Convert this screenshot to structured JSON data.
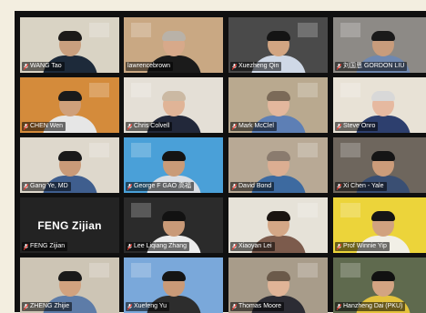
{
  "meeting": {
    "participants": [
      {
        "name": "WANG Tao",
        "muted": true,
        "bg": "#d9d3c4",
        "skin": "#c99f7e",
        "hair": "#1c1a18",
        "shirt": "#1d2a3a"
      },
      {
        "name": "lawrencebrown",
        "muted": false,
        "bg": "#c9a883",
        "skin": "#d7a98a",
        "hair": "#b9b2a8",
        "shirt": "#1b1b1b"
      },
      {
        "name": "Xuezheng Qin",
        "muted": true,
        "bg": "#4a4a4a",
        "skin": "#d2a582",
        "hair": "#141414",
        "shirt": "#cfd8e6"
      },
      {
        "name": "刘国恩 GORDON LIU",
        "muted": true,
        "bg": "#8d8a86",
        "skin": "#c89c7c",
        "hair": "#1a1a1a",
        "shirt": "#6f88b0"
      },
      {
        "name": "CHEN Wen",
        "muted": true,
        "bg": "#d48b3b",
        "skin": "#cfa07b",
        "hair": "#1a1a1a",
        "shirt": "#e6e6e6"
      },
      {
        "name": "Chris Colvell",
        "muted": true,
        "bg": "#e4dfd6",
        "skin": "#e0b497",
        "hair": "#cbb9a3",
        "shirt": "#22283a"
      },
      {
        "name": "Mark McClel",
        "muted": true,
        "bg": "#b9a98f",
        "skin": "#e3b79d",
        "hair": "#7b6a58",
        "shirt": "#5d7fb5"
      },
      {
        "name": "Steve Onro",
        "muted": true,
        "bg": "#e8e2d6",
        "skin": "#e6b9a0",
        "hair": "#d8d8d8",
        "shirt": "#2d3f6e"
      },
      {
        "name": "Gang Ye, MD",
        "muted": true,
        "bg": "#ded8cc",
        "skin": "#c99a78",
        "hair": "#191919",
        "shirt": "#3f5e8e"
      },
      {
        "name": "George F GAO 高福",
        "muted": true,
        "bg": "#4aa0d8",
        "skin": "#c99b78",
        "hair": "#141414",
        "shirt": "#d9dde3"
      },
      {
        "name": "David Bond",
        "muted": true,
        "bg": "#b8a995",
        "skin": "#dcae92",
        "hair": "#8a7b6e",
        "shirt": "#3d6aa0"
      },
      {
        "name": "Xi Chen - Yale",
        "muted": true,
        "bg": "#6e665d",
        "skin": "#cc9c7a",
        "hair": "#151515",
        "shirt": "#3a4f73"
      },
      {
        "name": "FENG Zijian",
        "muted": true,
        "bg": "#232323",
        "skin": "",
        "hair": "",
        "shirt": "",
        "avatar_text": "FENG Zijian"
      },
      {
        "name": "Lee Liqiang Zhang",
        "muted": true,
        "bg": "#2b2b2b",
        "skin": "#c99a78",
        "hair": "#121212",
        "shirt": "#ececec"
      },
      {
        "name": "Xiaoyan Lei",
        "muted": true,
        "bg": "#e6e2d8",
        "skin": "#d4a786",
        "hair": "#1a1410",
        "shirt": "#7c5b4c"
      },
      {
        "name": "Prof Winnie Yip",
        "muted": true,
        "bg": "#ecd43a",
        "skin": "#d1a27f",
        "hair": "#151515",
        "shirt": "#f1efe6"
      },
      {
        "name": "ZHENG Zhijie",
        "muted": true,
        "bg": "#cdc5b5",
        "skin": "#d1a27f",
        "hair": "#191919",
        "shirt": "#5d7ca8"
      },
      {
        "name": "Xuefeng Yu",
        "muted": true,
        "bg": "#7aa8da",
        "skin": "#c99a78",
        "hair": "#151515",
        "shirt": "#2d2d2d"
      },
      {
        "name": "Thomas Moore",
        "muted": true,
        "bg": "#a89c8a",
        "skin": "#e0b497",
        "hair": "#6b5a4a",
        "shirt": "#2c2c34",
        "active": true
      },
      {
        "name": "Hanzheng Dai (PKU)",
        "muted": true,
        "bg": "#5f6a4e",
        "skin": "#d3a482",
        "hair": "#111111",
        "shirt": "#e3c23c"
      }
    ]
  }
}
